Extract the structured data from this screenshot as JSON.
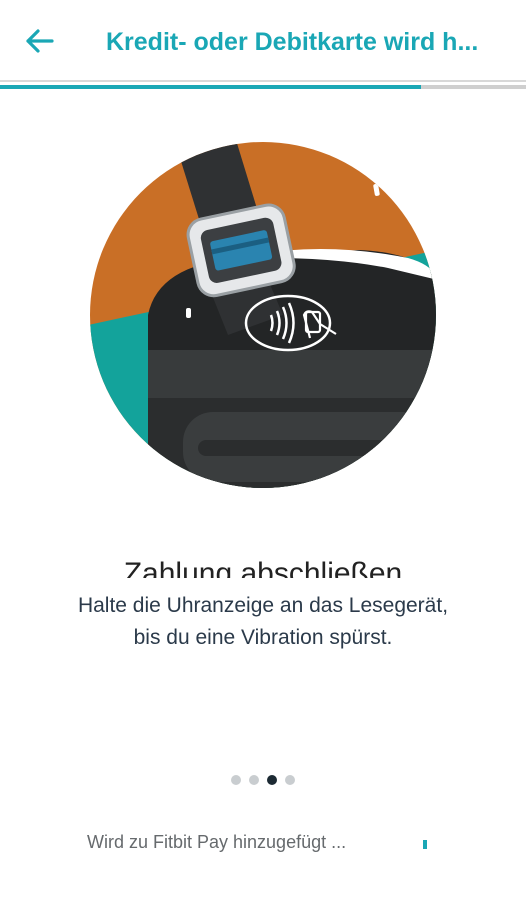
{
  "header": {
    "title": "Kredit- oder Debitkarte wird h...",
    "back_icon": "arrow-left-icon",
    "accent_color": "#1aa7b5"
  },
  "progress": {
    "value": 0.8
  },
  "illustration": {
    "icon": "contactless-payment-icon",
    "colors": {
      "orange": "#c96f26",
      "teal": "#13a39b",
      "dark": "#232526"
    }
  },
  "content": {
    "heading": "Zahlung abschließen",
    "description_line1": "Halte die Uhranzeige an das Lesegerät,",
    "description_line2": "bis du eine Vibration spürst."
  },
  "pagination": {
    "total": 4,
    "active_index": 2
  },
  "status": {
    "text": "Wird zu Fitbit Pay hinzugefügt ..."
  }
}
